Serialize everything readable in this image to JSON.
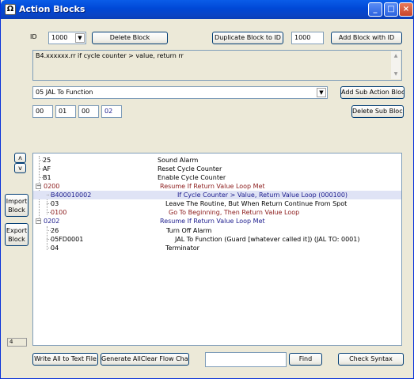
{
  "window": {
    "title": "Action Blocks",
    "app_icon": "Ω"
  },
  "toolbar": {
    "id_label": "ID",
    "id_value": "1000",
    "delete_block": "Delete Block",
    "duplicate_block": "Duplicate Block to ID",
    "dup_id_value": "1000",
    "add_block": "Add Block with ID"
  },
  "description": "B4.xxxxxx.rr if cycle counter > value, return rr",
  "sub_action": {
    "selected": "05 JAL To Function",
    "add_label": "Add Sub Action Block",
    "delete_label": "Delete Sub Block",
    "params": [
      "00",
      "01",
      "00",
      "02"
    ]
  },
  "side": {
    "up": "ʌ",
    "down": "v",
    "import": [
      "Import",
      "Block"
    ],
    "export": [
      "Export",
      "Block"
    ]
  },
  "tree": [
    {
      "code": "25",
      "name": "Sound Alarm",
      "level": 0,
      "color": "black"
    },
    {
      "code": "AF",
      "name": "Reset Cycle Counter",
      "level": 0,
      "color": "black"
    },
    {
      "code": "B1",
      "name": "Enable Cycle Counter",
      "level": 0,
      "color": "black"
    },
    {
      "code": "0200",
      "name": "Resume If Return Value Loop Met",
      "level": 0,
      "color": "red",
      "expander": "−"
    },
    {
      "code": "B400010002",
      "name": "If Cycle Counter > Value, Return Value Loop (000100)",
      "level": 1,
      "color": "blue",
      "selected": true
    },
    {
      "code": "03",
      "name": "Leave The Routine, But When Return Continue From Spot",
      "level": 1,
      "color": "black"
    },
    {
      "code": "0100",
      "name": "Go To Beginning, Then Return Value Loop",
      "level": 1,
      "color": "red"
    },
    {
      "code": "0202",
      "name": "Resume If Return Value Loop Met",
      "level": 0,
      "color": "blue",
      "expander": "−"
    },
    {
      "code": "26",
      "name": "Turn Off Alarm",
      "level": 1,
      "color": "black"
    },
    {
      "code": "05FD0001",
      "name": "JAL To Function (Guard [whatever called it]) (JAL TO: 0001)",
      "level": 1,
      "color": "black"
    },
    {
      "code": "04",
      "name": "Terminator",
      "level": 1,
      "color": "black"
    }
  ],
  "status_value": "4",
  "bottom": {
    "write_all": "Write All to Text File",
    "generate": "Generate AllClear Flow Charts",
    "search_value": "",
    "find": "Find",
    "check_syntax": "Check Syntax"
  },
  "colors": {
    "title_bar": "#0a5ce8",
    "accent_blue": "#1a1a8c",
    "accent_red": "#8b1a1a",
    "selection": "#dfe3f5"
  }
}
